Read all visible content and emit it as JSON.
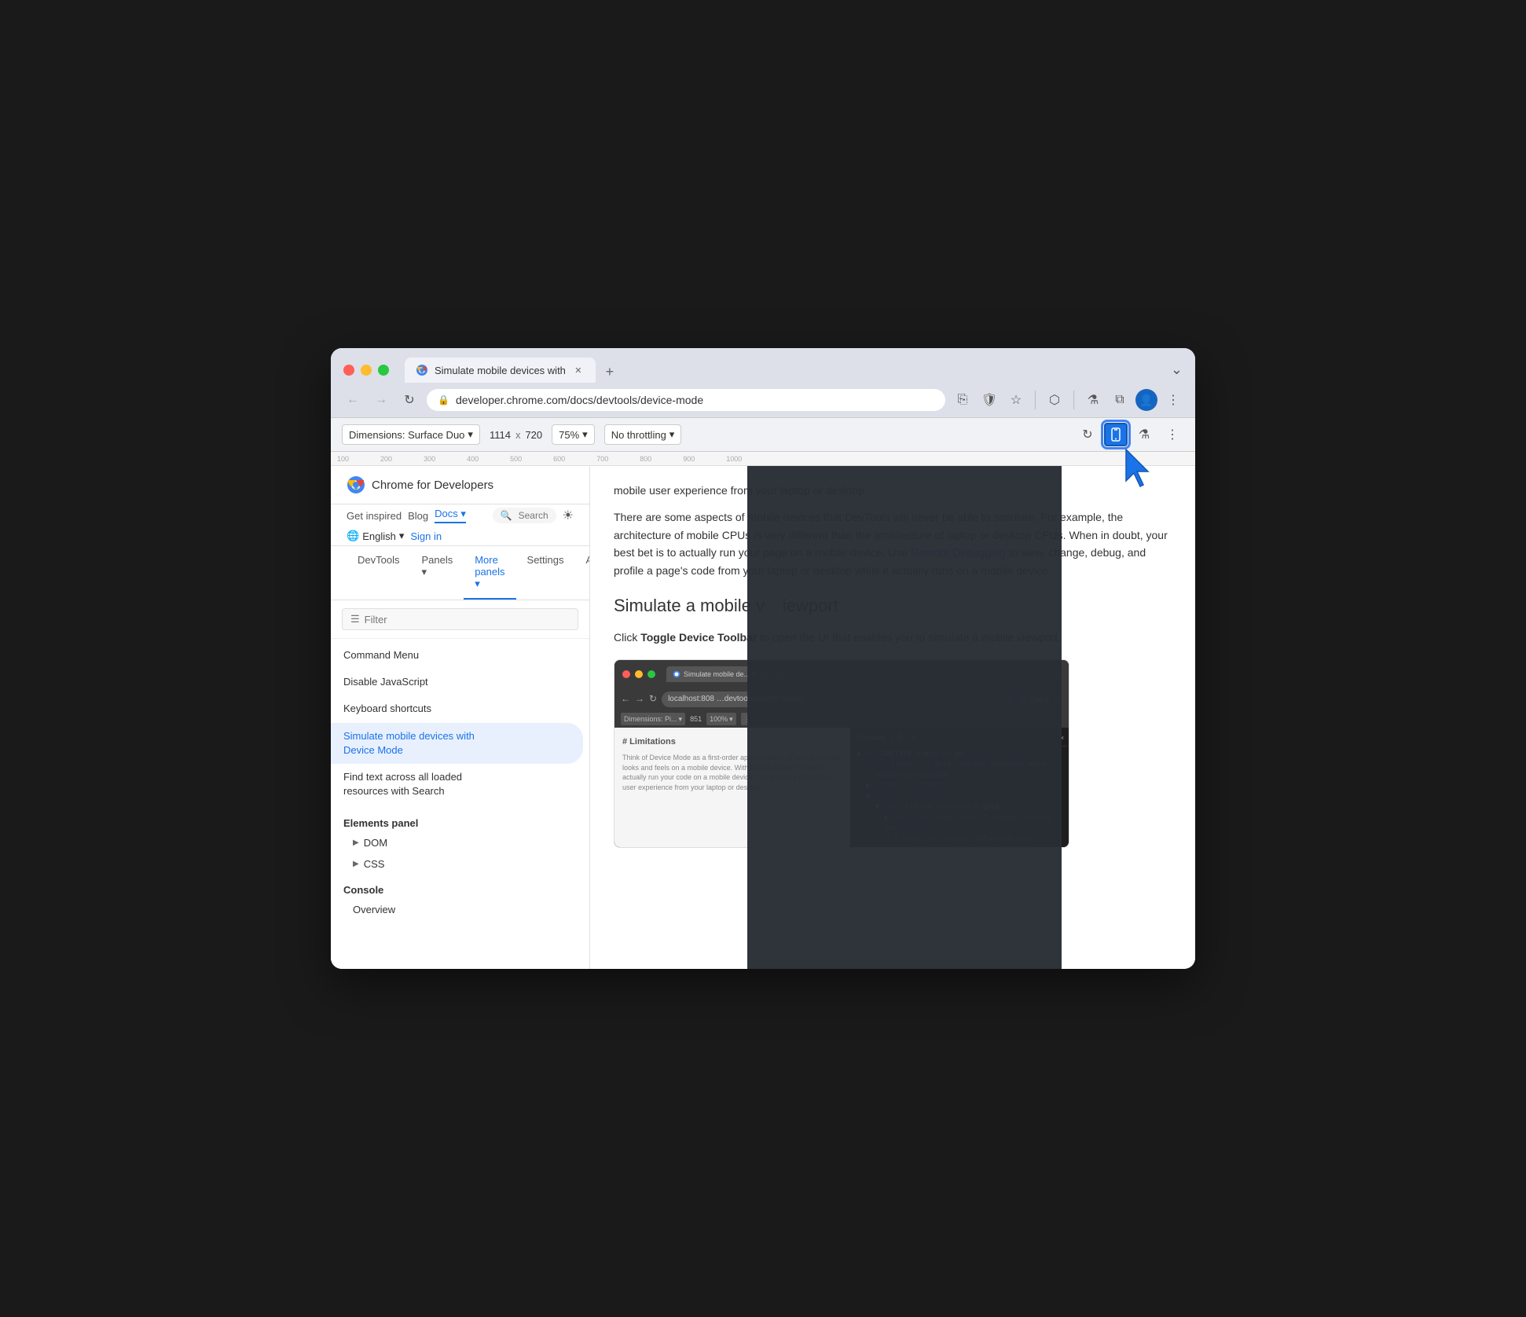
{
  "browser": {
    "traffic_lights": [
      "red",
      "yellow",
      "green"
    ],
    "tab": {
      "label": "Simulate mobile devices with",
      "favicon": "chrome"
    },
    "new_tab_label": "+",
    "more_label": "⌄",
    "nav": {
      "back": "←",
      "forward": "→",
      "refresh": "↻",
      "address": "developer.chrome.com/docs/devtools/device-mode",
      "cast_icon": "⎘",
      "shield_icon": "🛡",
      "star_icon": "☆",
      "ext_icon": "⬡",
      "beaker_icon": "⚗",
      "split_icon": "⧉",
      "profile_icon": "👤",
      "more_icon": "⋮"
    },
    "device_toolbar": {
      "dimensions_label": "Dimensions: Surface Duo",
      "width": "1114",
      "x_label": "x",
      "height": "720",
      "zoom": "75%",
      "zoom_arrow": "▾",
      "throttle": "No throttling",
      "throttle_arrow": "▾",
      "btn_rotate": "⟳",
      "btn_device": "📱",
      "btn_inspect": "⚗",
      "btn_more": "⋮"
    }
  },
  "site": {
    "logo_text": "Chrome for Developers",
    "nav_items": [
      "Get inspired",
      "Blog",
      "Docs ▾"
    ],
    "search_placeholder": "Search",
    "sun_icon": "☀",
    "language": "English",
    "lang_arrow": "▾",
    "sign_in": "Sign in"
  },
  "sub_nav": {
    "items": [
      "DevTools",
      "Panels ▾",
      "More panels ▾",
      "Settings",
      "Accessibility"
    ],
    "active_index": 3
  },
  "sidebar": {
    "filter_placeholder": "Filter",
    "nav_items": [
      "Command Menu",
      "Disable JavaScript",
      "Keyboard shortcuts",
      "Simulate mobile devices with\nDevice Mode",
      "Find text across all loaded\nresources with Search"
    ],
    "active_index": 3,
    "sections": [
      {
        "title": "Elements panel",
        "items": [
          "DOM",
          "CSS"
        ]
      },
      {
        "title": "Console",
        "items": [
          "Overview"
        ]
      }
    ]
  },
  "article": {
    "paragraph1": "mobile user experience from your laptop or desktop.",
    "paragraph2": "There are some aspects of mobile devices that DevTools will never be able to simulate. For example, the architecture of mobile CPUs is very different than the architecture of laptop or desktop CPUs. When in doubt, your best bet is to actually run your page on a mobile device. Use",
    "link1": "Remote Debugging",
    "paragraph2b": "to view, change, debug, and profile a page's code from your laptop or desktop while it actually runs on a mobile device.",
    "heading": "Simulate a mobile viewport",
    "click_text": "Click",
    "toggle_bold": "Toggle Device Toolbar",
    "click_text2": "to open the UI that enables you to simulate a mobile viewport.",
    "mini_browser": {
      "tab_label": "Simulate mobile de... th ×",
      "new_tab": "+",
      "address": "localhost:808",
      "address2": "devtools/device-mode/",
      "guest_label": "Guest",
      "more": "⋮",
      "device_label": "Dimensions: Pi...",
      "width": "851",
      "zoom": "100%",
      "panel_label": "Elements",
      "panel_more": "»",
      "panel_badge": "1",
      "panel_settings": "⚙",
      "panel_more2": "⋮",
      "panel_close": "×",
      "code_lines": [
        "◆ <!--!DOCTYPE html> == $0",
        "  <html lang=\"en\" data-cookies-accepted data-",
        "    banner-dismissed>",
        "  ▶ <head>...</head>",
        "  ▼ <body>",
        "    ▼ <div class=\"scaffold\"> grid",
        "      ▶ <top-nav role=\"banner\" class=\"display-bloc",
        "        k hairline-bottom\" data-side-nav-inert>...",
        "        </top-nav>",
        "      ▶ <top-nav>",
        "        </top-nav>",
        "      ▼ <navigation-rail role=\"navigation\" class=",
        "        \"lg:pad-left-200 lg:pad-right-200\" aria-",
        "        label=\"primary\" tabindex=\"-1\">...",
        "        </navigation-rail>"
      ],
      "page_content": "# Limitations",
      "page_subtext": "Think of Device Mode as a first-order approximation of how your page looks and feels on a mobile device. With Device Mode you don't actually run your code on a mobile device. You simulate the mobile user experience from your laptop or desktop."
    }
  },
  "cursor": {
    "visible": true
  }
}
